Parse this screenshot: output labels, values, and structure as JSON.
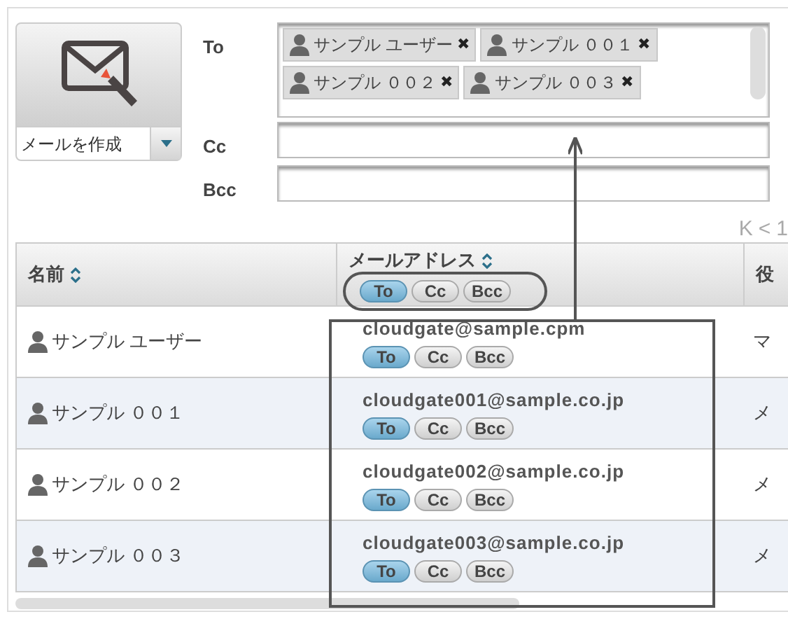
{
  "compose": {
    "label": "メールを作成"
  },
  "recipients": [
    {
      "label": "To",
      "chips": [
        {
          "name": "サンプル ユーザー",
          "remove": "✖"
        },
        {
          "name": "サンプル ００１",
          "remove": "✖"
        },
        {
          "name": "サンプル ００２",
          "remove": "✖"
        },
        {
          "name": "サンプル ００３",
          "remove": "✖"
        }
      ]
    },
    {
      "label": "Cc"
    },
    {
      "label": "Bcc"
    }
  ],
  "pagination": [
    "K",
    "<",
    "1"
  ],
  "table": {
    "columns": [
      {
        "label": "名前",
        "sortable": true
      },
      {
        "label": "メールアドレス",
        "sortable": true,
        "filters": [
          {
            "label": "To",
            "selected": true
          },
          {
            "label": "Cc",
            "selected": false
          },
          {
            "label": "Bcc",
            "selected": false
          }
        ]
      },
      {
        "label": "役",
        "sortable": false
      }
    ],
    "rows": [
      {
        "name": "サンプル ユーザー",
        "email": "cloudgate@sample.cpm",
        "targets": [
          {
            "label": "To",
            "selected": true
          },
          {
            "label": "Cc",
            "selected": false
          },
          {
            "label": "Bcc",
            "selected": false
          }
        ],
        "column_3": "マ"
      },
      {
        "name": "サンプル ００１",
        "email": "cloudgate001@sample.co.jp",
        "targets": [
          {
            "label": "To",
            "selected": true
          },
          {
            "label": "Cc",
            "selected": false
          },
          {
            "label": "Bcc",
            "selected": false
          }
        ],
        "column_3": "メ"
      },
      {
        "name": "サンプル ００２",
        "email": "cloudgate002@sample.co.jp",
        "targets": [
          {
            "label": "To",
            "selected": true
          },
          {
            "label": "Cc",
            "selected": false
          },
          {
            "label": "Bcc",
            "selected": false
          }
        ],
        "column_3": "メ"
      },
      {
        "name": "サンプル ００３",
        "email": "cloudgate003@sample.co.jp",
        "targets": [
          {
            "label": "To",
            "selected": true
          },
          {
            "label": "Cc",
            "selected": false
          },
          {
            "label": "Bcc",
            "selected": false
          }
        ],
        "column_3": "メ"
      }
    ]
  }
}
